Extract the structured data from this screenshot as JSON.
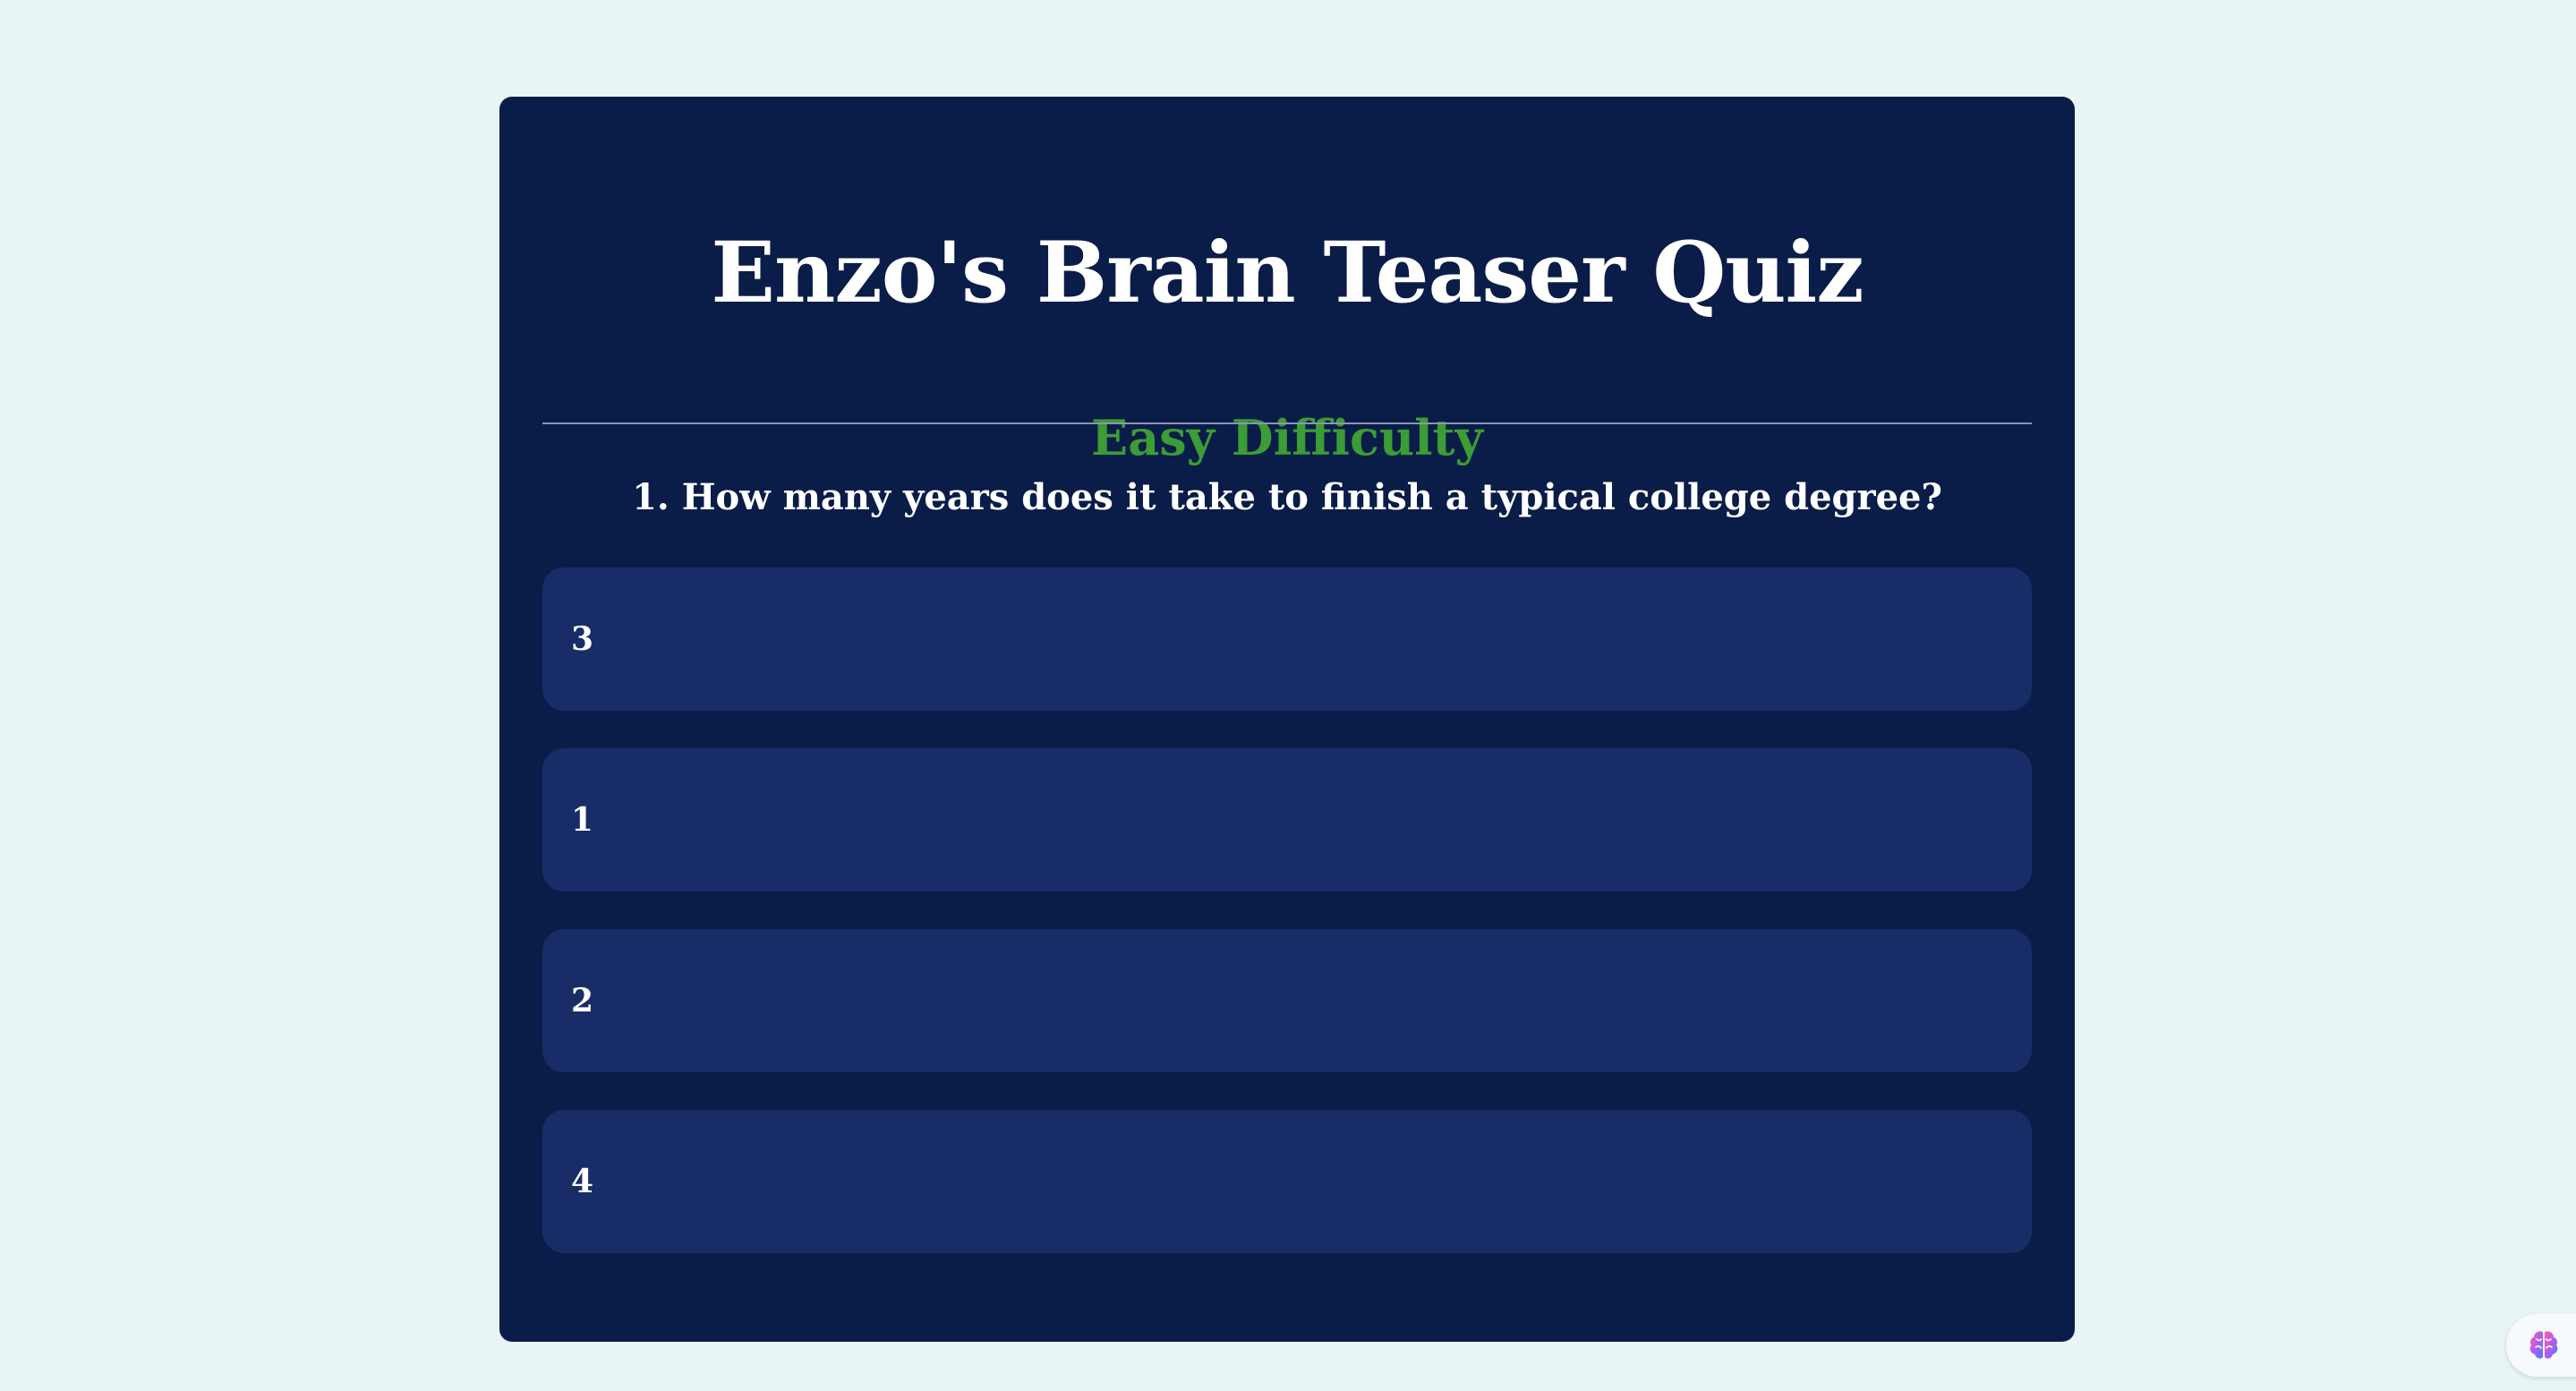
{
  "quiz": {
    "title": "Enzo's Brain Teaser Quiz",
    "difficulty": "Easy Difficulty",
    "question": "1. How many years does it take to finish a typical college degree?",
    "options": [
      {
        "label": "3"
      },
      {
        "label": "1"
      },
      {
        "label": "2"
      },
      {
        "label": "4"
      }
    ]
  },
  "colors": {
    "page_background": "#e8f4f6",
    "card_background": "#0a1c48",
    "option_background": "#182d67",
    "difficulty_accent": "#3c9c35",
    "text": "#ffffff"
  },
  "helper": {
    "icon": "brain-icon"
  }
}
